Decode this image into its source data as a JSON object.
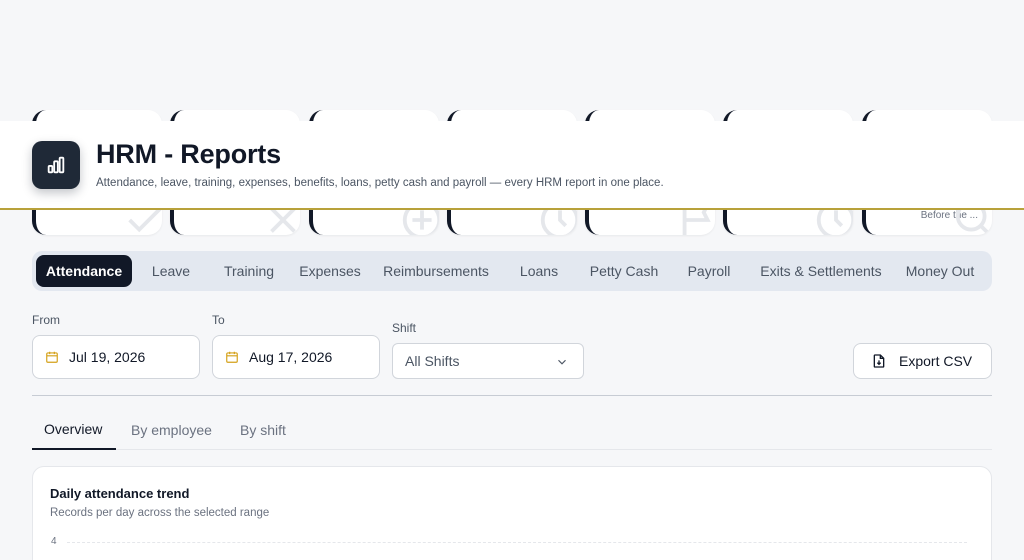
{
  "header": {
    "title": "HRM - Reports",
    "subtitle": "Attendance, leave, training, expenses, benefits, loans, petty cash and payroll — every HRM report in one place.",
    "logo_icon": "bar-chart-icon"
  },
  "stat_cards": [
    {
      "icon": "check-icon"
    },
    {
      "icon": "close-icon"
    },
    {
      "icon": "plus-circle-icon"
    },
    {
      "icon": "clock-icon"
    },
    {
      "icon": "flag-icon"
    },
    {
      "icon": "clock-icon"
    },
    {
      "icon": "search-icon",
      "note": "Before the ..."
    }
  ],
  "tabs": [
    {
      "label": "Attendance",
      "active": true
    },
    {
      "label": "Leave"
    },
    {
      "label": "Training"
    },
    {
      "label": "Expenses"
    },
    {
      "label": "Reimbursements"
    },
    {
      "label": "Loans"
    },
    {
      "label": "Petty Cash"
    },
    {
      "label": "Payroll"
    },
    {
      "label": "Exits & Settlements"
    },
    {
      "label": "Money Out"
    }
  ],
  "filters": {
    "from_label": "From",
    "from_value": "Jul 19, 2026",
    "to_label": "To",
    "to_value": "Aug 17, 2026",
    "shift_label": "Shift",
    "shift_value": "All Shifts"
  },
  "export_label": "Export CSV",
  "subtabs": [
    {
      "label": "Overview",
      "active": true
    },
    {
      "label": "By employee"
    },
    {
      "label": "By shift"
    }
  ],
  "chart": {
    "title": "Daily attendance trend",
    "subtitle": "Records per day across the selected range",
    "y_top_tick": "4"
  },
  "colors": {
    "accent_dark": "#111827",
    "gold": "#b8a13a",
    "calendar_icon": "#d4a017"
  }
}
